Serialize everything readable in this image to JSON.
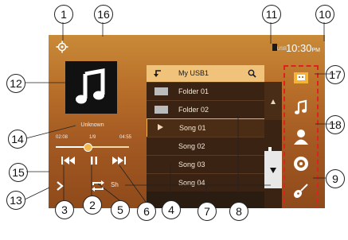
{
  "status": {
    "time": "10:30",
    "time_suffix": "PM",
    "device_indicator": "USB"
  },
  "now_playing": {
    "title": "Unknown",
    "elapsed": "02:08",
    "track_fraction": "1/9",
    "total": "04:55",
    "progress_fraction": 0.44,
    "shuffle_indicator": "Sh"
  },
  "browser": {
    "folder_name": "My USB1",
    "items": [
      {
        "type": "folder",
        "label": "Folder 01"
      },
      {
        "type": "folder",
        "label": "Folder 02"
      },
      {
        "type": "song",
        "label": "Song 01",
        "playing": true
      },
      {
        "type": "song",
        "label": "Song 02"
      },
      {
        "type": "song",
        "label": "Song 03"
      },
      {
        "type": "song",
        "label": "Song 04"
      }
    ]
  },
  "sidebar": {
    "sources": [
      "usb-icon",
      "music-note-icon",
      "contact-icon",
      "disc-icon",
      "guitar-icon"
    ]
  },
  "callouts": [
    "1",
    "2",
    "3",
    "4",
    "5",
    "6",
    "7",
    "8",
    "9",
    "10",
    "11",
    "12",
    "13",
    "14",
    "15",
    "16",
    "17",
    "18"
  ],
  "colors": {
    "accent": "#f0c27a",
    "highlight_border": "#f0b04a",
    "sidebar_frame": "#e02020"
  }
}
